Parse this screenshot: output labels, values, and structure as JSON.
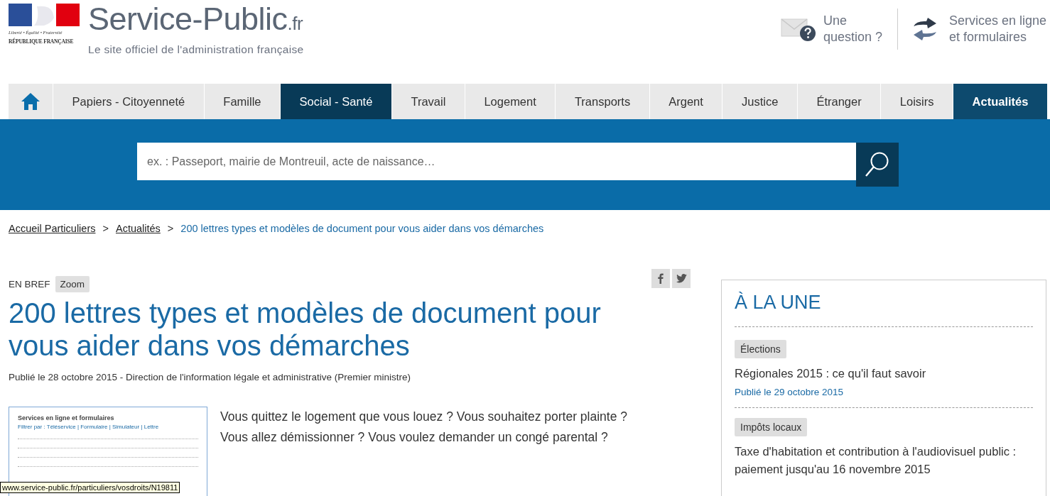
{
  "logo": {
    "motto": "Liberté • Égalité • Fraternité",
    "republic": "RÉPUBLIQUE FRANÇAISE",
    "site_name": "Service-Public",
    "site_suffix": ".fr",
    "tagline": "Le site officiel de l'administration française"
  },
  "header_links": [
    {
      "kind": "question",
      "label": "Une question ?"
    },
    {
      "kind": "services",
      "label": "Services en ligne et formulaires"
    }
  ],
  "nav": [
    {
      "kind": "home",
      "selected": false
    },
    {
      "kind": "link",
      "label": "Papiers - Citoyenneté",
      "selected": false
    },
    {
      "kind": "link",
      "label": "Famille",
      "selected": false
    },
    {
      "kind": "link",
      "label": "Social - Santé",
      "selected": true
    },
    {
      "kind": "link",
      "label": "Travail",
      "selected": false
    },
    {
      "kind": "link",
      "label": "Logement",
      "selected": false
    },
    {
      "kind": "link",
      "label": "Transports",
      "selected": false
    },
    {
      "kind": "link",
      "label": "Argent",
      "selected": false
    },
    {
      "kind": "link",
      "label": "Justice",
      "selected": false
    },
    {
      "kind": "link",
      "label": "Étranger",
      "selected": false
    },
    {
      "kind": "link",
      "label": "Loisirs",
      "selected": false
    },
    {
      "kind": "featured",
      "label": "Actualités",
      "selected": false
    }
  ],
  "search": {
    "placeholder": "ex. : Passeport, mairie de Montreuil, acte de naissance…"
  },
  "breadcrumb": [
    {
      "label": "Accueil Particuliers",
      "kind": "link"
    },
    {
      "label": "Actualités",
      "kind": "link"
    },
    {
      "label": "200 lettres types et modèles de document pour vous aider dans vos démarches",
      "kind": "current"
    }
  ],
  "breadcrumb_separator": ">",
  "article": {
    "category": "EN BREF",
    "tag": "Zoom",
    "title": "200 lettres types et modèles de document pour vous aider dans vos démarches",
    "byline": "Publié le 28 octobre 2015 - Direction de l'information légale et administrative (Premier ministre)",
    "preview": {
      "title": "Services en ligne et formulaires",
      "filter": "Filtrer par : Téléservice | Formulaire | Simulateur | Lettre"
    },
    "intro": [
      "Vous quittez le logement que vous louez ? Vous souhaitez porter plainte ?",
      "Vous allez démissionner ? Vous voulez demander un congé parental ?"
    ]
  },
  "sidebar": {
    "title": "À LA UNE",
    "items": [
      {
        "tag": "Élections",
        "title": "Régionales 2015 : ce qu'il faut savoir",
        "date": "Publié le 29 octobre 2015"
      },
      {
        "tag": "Impôts locaux",
        "title": "Taxe d'habitation et contribution à l'audiovisuel public : paiement jusqu'au 16 novembre 2015"
      }
    ]
  },
  "status_url": "www.service-public.fr/particuliers/vosdroits/N19811"
}
